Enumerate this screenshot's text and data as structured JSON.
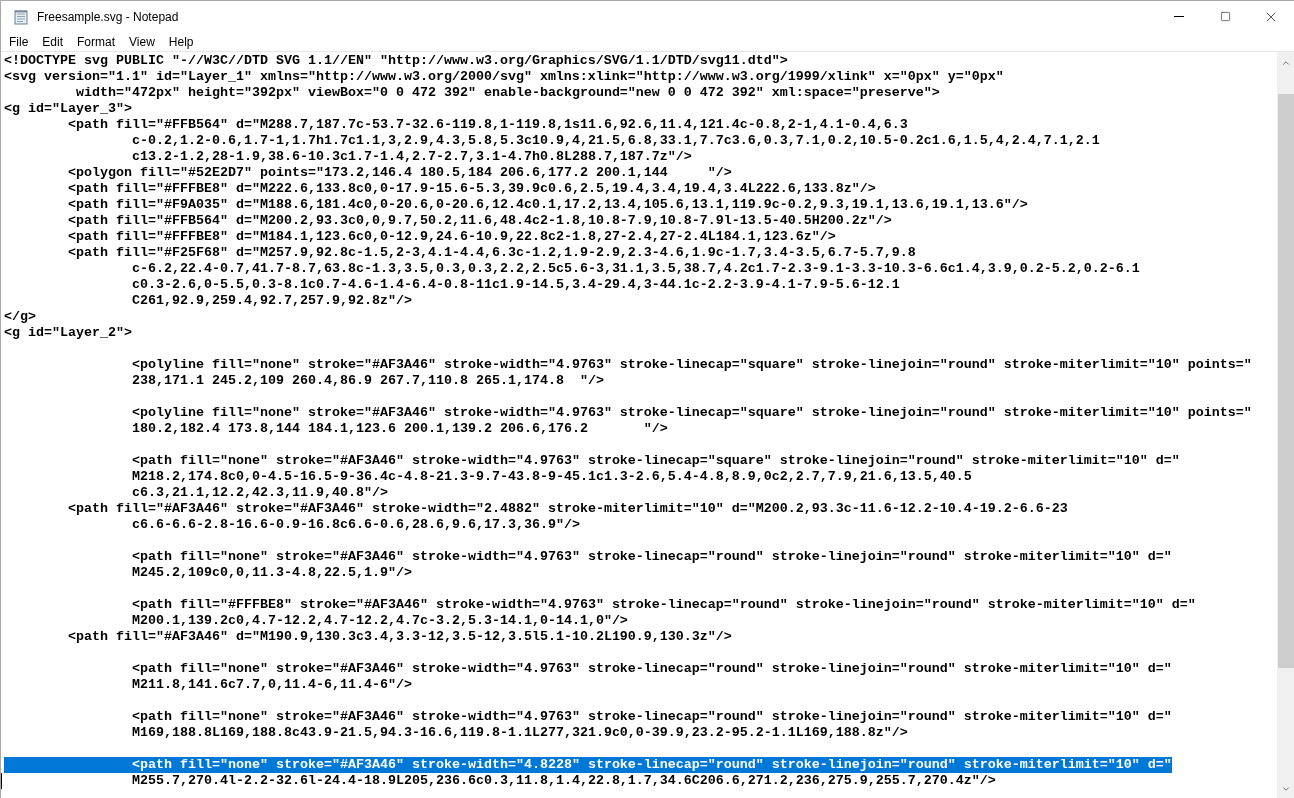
{
  "window": {
    "title": "Freesample.svg - Notepad"
  },
  "menu": [
    "File",
    "Edit",
    "Format",
    "View",
    "Help"
  ],
  "editor": {
    "lines": [
      {
        "text": "<!DOCTYPE svg PUBLIC \"-//W3C//DTD SVG 1.1//EN\" \"http://www.w3.org/Graphics/SVG/1.1/DTD/svg11.dtd\">",
        "selected": false,
        "caret": false
      },
      {
        "text": "<svg version=\"1.1\" id=\"Layer_1\" xmlns=\"http://www.w3.org/2000/svg\" xmlns:xlink=\"http://www.w3.org/1999/xlink\" x=\"0px\" y=\"0px\"",
        "selected": false,
        "caret": false
      },
      {
        "text": "\t width=\"472px\" height=\"392px\" viewBox=\"0 0 472 392\" enable-background=\"new 0 0 472 392\" xml:space=\"preserve\">",
        "selected": false,
        "caret": false
      },
      {
        "text": "<g id=\"Layer_3\">",
        "selected": false,
        "caret": false
      },
      {
        "text": "\t<path fill=\"#FFB564\" d=\"M288.7,187.7c-53.7-32.6-119.8,1-119.8,1s11.6,92.6,11.4,121.4c-0.8,2-1,4.1-0.4,6.3",
        "selected": false,
        "caret": false
      },
      {
        "text": "\t\tc-0.2,1.2-0.6,1.7-1,1.7h1.7c1.1,3,2.9,4.3,5.8,5.3c10.9,4,21.5,6.8,33.1,7.7c3.6,0.3,7.1,0.2,10.5-0.2c1.6,1.5,4,2.4,7.1,2.1",
        "selected": false,
        "caret": false
      },
      {
        "text": "\t\tc13.2-1.2,28-1.9,38.6-10.3c1.7-1.4,2.7-2.7,3.1-4.7h0.8L288.7,187.7z\"/>",
        "selected": false,
        "caret": false
      },
      {
        "text": "\t<polygon fill=\"#52E2D7\" points=\"173.2,146.4 180.5,184 206.6,177.2 200.1,144\t\"/>",
        "selected": false,
        "caret": false
      },
      {
        "text": "\t<path fill=\"#FFFBE8\" d=\"M222.6,133.8c0,0-17.9-15.6-5.3,39.9c0.6,2.5,19.4,3.4,19.4,3.4L222.6,133.8z\"/>",
        "selected": false,
        "caret": false
      },
      {
        "text": "\t<path fill=\"#F9A035\" d=\"M188.6,181.4c0,0-20.6,0-20.6,12.4c0.1,17.2,13.4,105.6,13.1,119.9c-0.2,9.3,19.1,13.6,19.1,13.6\"/>",
        "selected": false,
        "caret": false
      },
      {
        "text": "\t<path fill=\"#FFB564\" d=\"M200.2,93.3c0,0,9.7,50.2,11.6,48.4c2-1.8,10.8-7.9,10.8-7.9l-13.5-40.5H200.2z\"/>",
        "selected": false,
        "caret": false
      },
      {
        "text": "\t<path fill=\"#FFFBE8\" d=\"M184.1,123.6c0,0-12.9,24.6-10.9,22.8c2-1.8,27-2.4,27-2.4L184.1,123.6z\"/>",
        "selected": false,
        "caret": false
      },
      {
        "text": "\t<path fill=\"#F25F68\" d=\"M257.9,92.8c-1.5,2-3,4.1-4.4,6.3c-1.2,1.9-2.9,2.3-4.6,1.9c-1.7,3.4-3.5,6.7-5.7,9.8",
        "selected": false,
        "caret": false
      },
      {
        "text": "\t\tc-6.2,22.4-0.7,41.7-8.7,63.8c-1.3,3.5,0.3,0.3,2.2,2.5c5.6-3,31.1,3.5,38.7,4.2c1.7-2.3-9.1-3.3-10.3-6.6c1.4,3.9,0.2-5.2,0.2-6.1",
        "selected": false,
        "caret": false
      },
      {
        "text": "\t\tc0.3-2.6,0-5.5,0.3-8.1c0.7-4.6-1.4-6.4-0.8-11c1.9-14.5,3.4-29.4,3-44.1c-2.2-3.9-4.1-7.9-5.6-12.1",
        "selected": false,
        "caret": false
      },
      {
        "text": "\t\tC261,92.9,259.4,92.7,257.9,92.8z\"/>",
        "selected": false,
        "caret": false
      },
      {
        "text": "</g>",
        "selected": false,
        "caret": false
      },
      {
        "text": "<g id=\"Layer_2\">",
        "selected": false,
        "caret": false
      },
      {
        "selected": false,
        "caret": false
      },
      {
        "text": "\t\t<polyline fill=\"none\" stroke=\"#AF3A46\" stroke-width=\"4.9763\" stroke-linecap=\"square\" stroke-linejoin=\"round\" stroke-miterlimit=\"10\" points=\"",
        "selected": false,
        "caret": false
      },
      {
        "text": "\t\t238,171.1 245.2,109 260.4,86.9 267.7,110.8 265.1,174.8  \"/>",
        "selected": false,
        "caret": false
      },
      {
        "selected": false,
        "caret": false
      },
      {
        "text": "\t\t<polyline fill=\"none\" stroke=\"#AF3A46\" stroke-width=\"4.9763\" stroke-linecap=\"square\" stroke-linejoin=\"round\" stroke-miterlimit=\"10\" points=\"",
        "selected": false,
        "caret": false
      },
      {
        "text": "\t\t180.2,182.4 173.8,144 184.1,123.6 200.1,139.2 206.6,176.2\t\"/>",
        "selected": false,
        "caret": false
      },
      {
        "selected": false,
        "caret": false
      },
      {
        "text": "\t\t<path fill=\"none\" stroke=\"#AF3A46\" stroke-width=\"4.9763\" stroke-linecap=\"square\" stroke-linejoin=\"round\" stroke-miterlimit=\"10\" d=\"",
        "selected": false,
        "caret": false
      },
      {
        "text": "\t\tM218.2,174.8c0,0-4.5-16.5-9-36.4c-4.8-21.3-9.7-43.8-9-45.1c1.3-2.6,5.4-4.8,8.9,0c2,2.7,7.9,21.6,13.5,40.5",
        "selected": false,
        "caret": false
      },
      {
        "text": "\t\tc6.3,21.1,12.2,42.3,11.9,40.8\"/>",
        "selected": false,
        "caret": false
      },
      {
        "text": "\t<path fill=\"#AF3A46\" stroke=\"#AF3A46\" stroke-width=\"2.4882\" stroke-miterlimit=\"10\" d=\"M200.2,93.3c-11.6-12.2-10.4-19.2-6.6-23",
        "selected": false,
        "caret": false
      },
      {
        "text": "\t\tc6.6-6.6-2.8-16.6-0.9-16.8c6.6-0.6,28.6,9.6,17.3,36.9\"/>",
        "selected": false,
        "caret": false
      },
      {
        "selected": false,
        "caret": false
      },
      {
        "text": "\t\t<path fill=\"none\" stroke=\"#AF3A46\" stroke-width=\"4.9763\" stroke-linecap=\"round\" stroke-linejoin=\"round\" stroke-miterlimit=\"10\" d=\"",
        "selected": false,
        "caret": false
      },
      {
        "text": "\t\tM245.2,109c0,0,11.3-4.8,22.5,1.9\"/>",
        "selected": false,
        "caret": false
      },
      {
        "selected": false,
        "caret": false
      },
      {
        "text": "\t\t<path fill=\"#FFFBE8\" stroke=\"#AF3A46\" stroke-width=\"4.9763\" stroke-linecap=\"round\" stroke-linejoin=\"round\" stroke-miterlimit=\"10\" d=\"",
        "selected": false,
        "caret": false
      },
      {
        "text": "\t\tM200.1,139.2c0,4.7-12.2,4.7-12.2,4.7c-3.2,5.3-14.1,0-14.1,0\"/>",
        "selected": false,
        "caret": false
      },
      {
        "text": "\t<path fill=\"#AF3A46\" d=\"M190.9,130.3c3.4,3.3-12,3.5-12,3.5l5.1-10.2L190.9,130.3z\"/>",
        "selected": false,
        "caret": false
      },
      {
        "selected": false,
        "caret": false
      },
      {
        "text": "\t\t<path fill=\"none\" stroke=\"#AF3A46\" stroke-width=\"4.9763\" stroke-linecap=\"round\" stroke-linejoin=\"round\" stroke-miterlimit=\"10\" d=\"",
        "selected": false,
        "caret": false
      },
      {
        "text": "\t\tM211.8,141.6c7.7,0,11.4-6,11.4-6\"/>",
        "selected": false,
        "caret": false
      },
      {
        "selected": false,
        "caret": false
      },
      {
        "text": "\t\t<path fill=\"none\" stroke=\"#AF3A46\" stroke-width=\"4.9763\" stroke-linecap=\"round\" stroke-linejoin=\"round\" stroke-miterlimit=\"10\" d=\"",
        "selected": false,
        "caret": false
      },
      {
        "text": "\t\tM169,188.8L169,188.8c43.9-21.5,94.3-16.6,119.8-1.1L277,321.9c0,0-39.9,23.2-95.2-1.1L169,188.8z\"/>",
        "selected": false,
        "caret": false
      },
      {
        "selected": false,
        "caret": false
      },
      {
        "text": "\t\t<path fill=\"none\" stroke=\"#AF3A46\" stroke-width=\"4.8228\" stroke-linecap=\"round\" stroke-linejoin=\"round\" stroke-miterlimit=\"10\" d=\"",
        "selected": true,
        "caret": false
      },
      {
        "text": "\t\tM255.7,270.4l-2.2-32.6l-24.4-18.9L205,236.6c0.3,11.8,1.4,22.8,1.7,34.6C206.6,271.2,236,275.9,255.7,270.4z\"/>",
        "selected": false,
        "caret": true
      }
    ]
  }
}
